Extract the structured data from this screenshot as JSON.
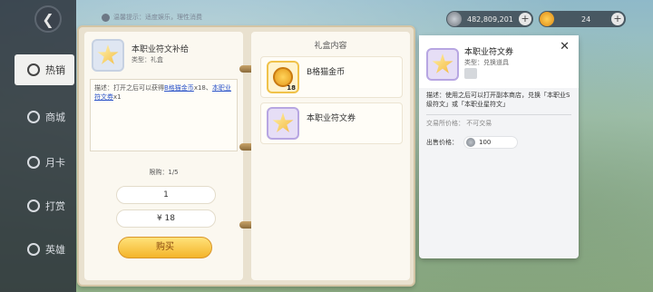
{
  "top": {
    "hint": "温馨提示：适度娱乐，理性消费",
    "currency1": {
      "value": "482,809,201",
      "icon": "silver-coin-icon"
    },
    "currency2": {
      "value": "24",
      "icon": "cat-coin-icon"
    }
  },
  "sidebar": {
    "items": [
      {
        "label": "热销",
        "icon": "chart-icon",
        "active": true
      },
      {
        "label": "商城",
        "icon": "shop-icon",
        "active": false
      },
      {
        "label": "月卡",
        "icon": "crown-icon",
        "active": false
      },
      {
        "label": "打赏",
        "icon": "gift-icon",
        "active": false
      },
      {
        "label": "英雄",
        "icon": "hero-icon",
        "active": false
      }
    ]
  },
  "product": {
    "title": "本职业符文补给",
    "type": "类型：礼盒",
    "desc_prefix": "描述：打开之后可以获得",
    "desc_link1": "B格猫金币",
    "desc_mid": "x18、",
    "desc_link2": "本职业符文券",
    "desc_suffix": "x1",
    "limit": "限购：1/5",
    "quantity": "1",
    "price": "¥ 18",
    "buy_label": "购买"
  },
  "gift": {
    "title": "礼盒内容",
    "items": [
      {
        "label": "B格猫金币",
        "count": "18"
      },
      {
        "label": "本职业符文券",
        "count": ""
      }
    ]
  },
  "detail": {
    "title": "本职业符文券",
    "type": "类型：兑换道具",
    "desc": "描述：使用之后可以打开副本商店，兑换「本职业S级符文」或「本职业星符文」",
    "trade": "交易所价格：  不可交易",
    "sell_label": "出售价格：",
    "sell_value": "100"
  },
  "colors": {
    "accent": "#f4b42a",
    "link": "#2a52c8"
  }
}
